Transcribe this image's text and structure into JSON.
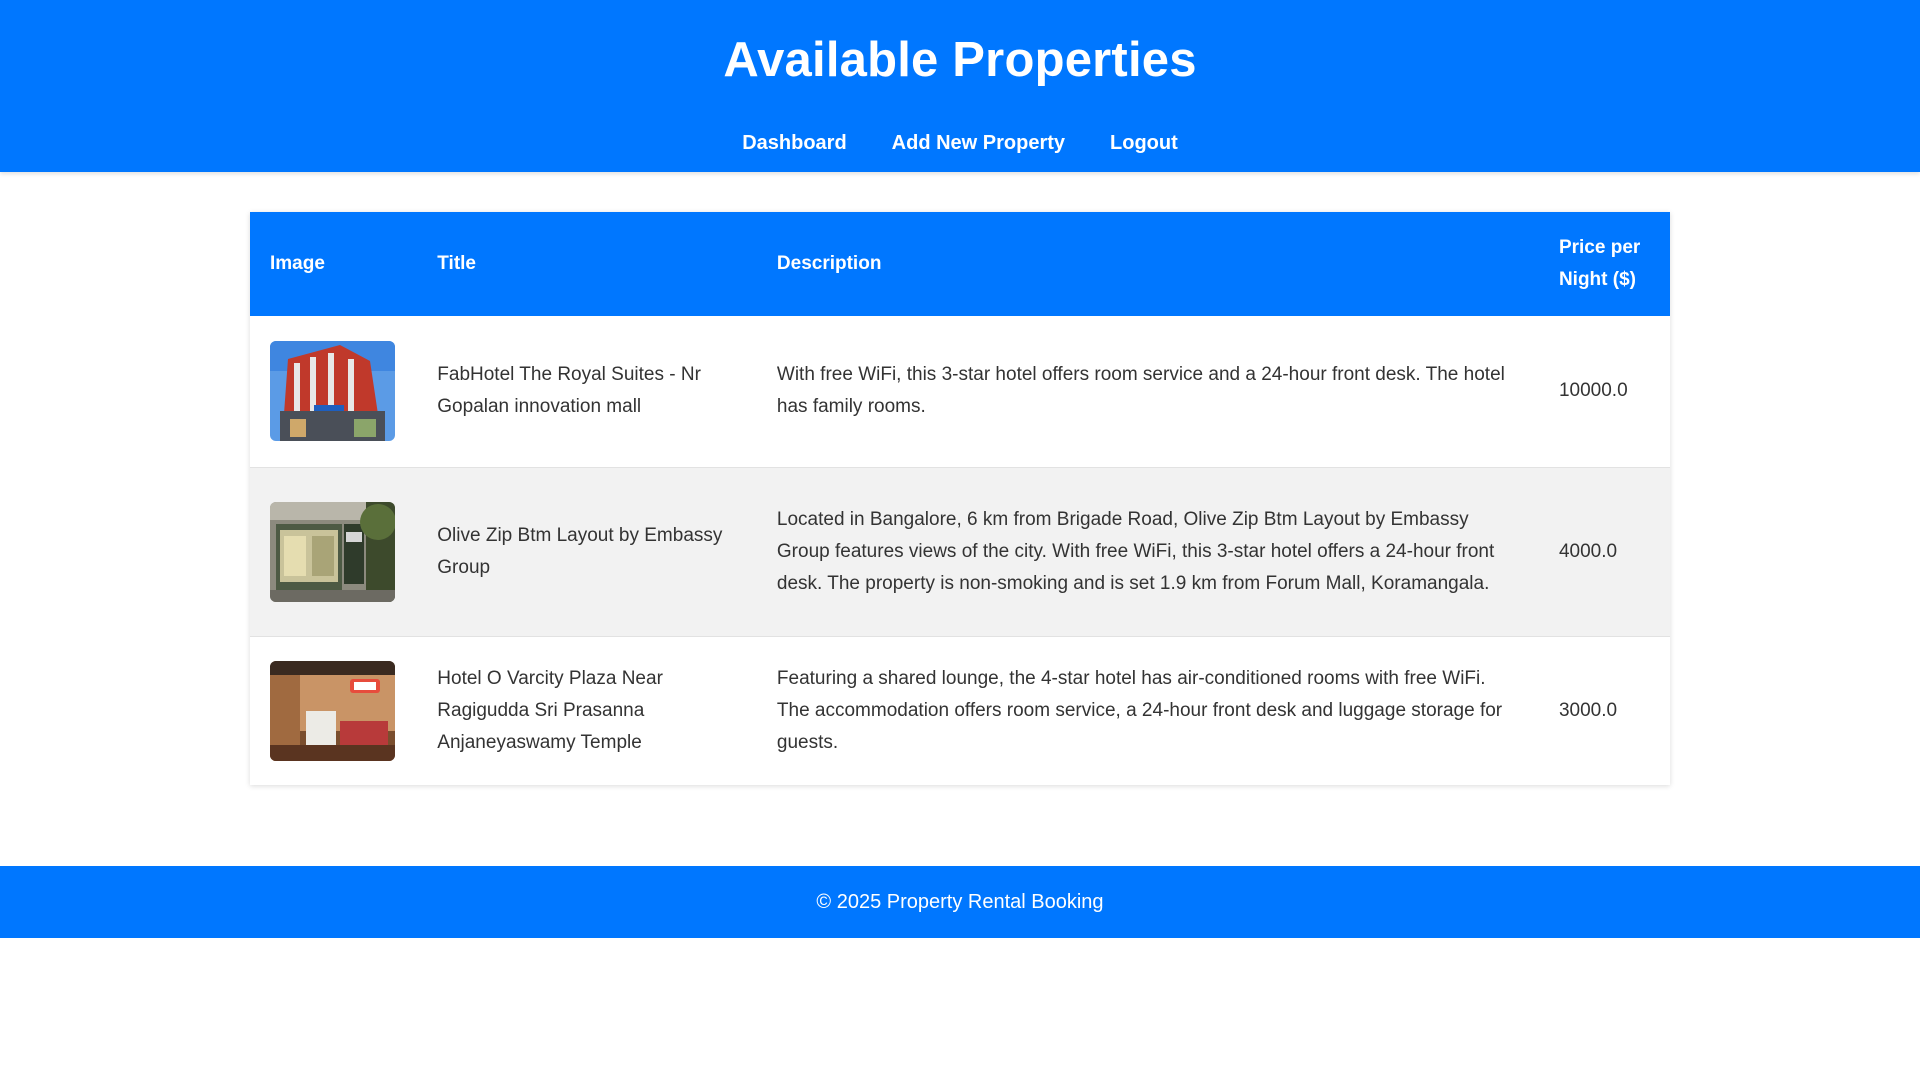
{
  "header": {
    "title": "Available Properties",
    "nav": [
      "Dashboard",
      "Add New Property",
      "Logout"
    ]
  },
  "table": {
    "columns": [
      "Image",
      "Title",
      "Description",
      "Price per Night ($)"
    ],
    "rows": [
      {
        "title": "FabHotel The Royal Suites - Nr Gopalan innovation mall",
        "description": "With free WiFi, this 3-star hotel offers room service and a 24-hour front desk. The hotel has family rooms.",
        "price": "10000.0"
      },
      {
        "title": "Olive Zip Btm Layout by Embassy Group",
        "description": "Located in Bangalore, 6 km from Brigade Road, Olive Zip Btm Layout by Embassy Group features views of the city. With free WiFi, this 3-star hotel offers a 24-hour front desk. The property is non-smoking and is set 1.9 km from Forum Mall, Koramangala.",
        "price": "4000.0"
      },
      {
        "title": "Hotel O Varcity Plaza Near Ragigudda Sri Prasanna Anjaneyaswamy Temple",
        "description": "Featuring a shared lounge, the 4-star hotel has air-conditioned rooms with free WiFi. The accommodation offers room service, a 24-hour front desk and luggage storage for guests.",
        "price": "3000.0"
      }
    ]
  },
  "footer": {
    "text": "© 2025 Property Rental Booking"
  },
  "colors": {
    "brand": "#0077ff",
    "row_alt": "#f2f2f2",
    "text": "#333333"
  }
}
